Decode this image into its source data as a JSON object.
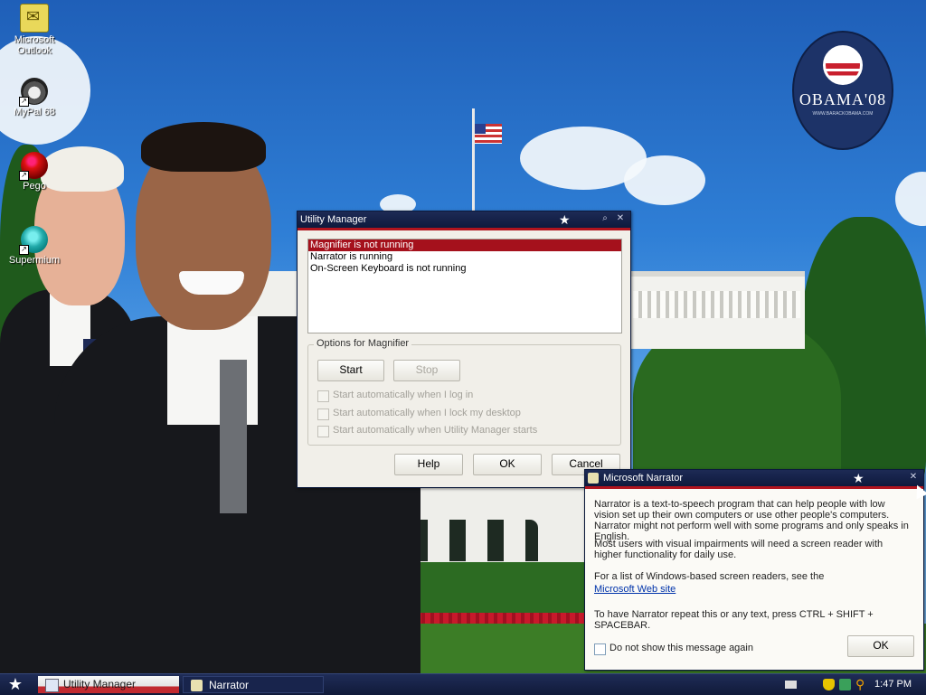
{
  "desktop": {
    "icons": [
      {
        "label": "Microsoft Outlook",
        "icon": "outlook-icon"
      },
      {
        "label": "MyPal 68",
        "icon": "mypal-icon"
      },
      {
        "label": "Pego",
        "icon": "pego-icon"
      },
      {
        "label": "Supermium",
        "icon": "supermium-icon"
      }
    ],
    "logo": {
      "text": "OBAMA'08",
      "subtext": "WWW.BARACKOBAMA.COM"
    }
  },
  "utility_manager": {
    "title": "Utility Manager",
    "list": [
      {
        "text": "Magnifier is not running",
        "selected": true
      },
      {
        "text": "Narrator is running",
        "selected": false
      },
      {
        "text": "On-Screen Keyboard is not running",
        "selected": false
      }
    ],
    "options_label": "Options for Magnifier",
    "start_label": "Start",
    "stop_label": "Stop",
    "checkboxes": [
      "Start automatically when I log in",
      "Start automatically when I lock my desktop",
      "Start automatically when Utility Manager starts"
    ],
    "help_label": "Help",
    "ok_label": "OK",
    "cancel_label": "Cancel"
  },
  "narrator": {
    "title": "Microsoft Narrator",
    "para1": "Narrator is a text-to-speech program that can help people with low vision set up their own computers or use other people's computers. Narrator might not perform well with some programs and only speaks in English.",
    "para2": "Most users with visual impairments will need a screen reader with higher functionality for daily use.",
    "para3": "For a list of Windows-based screen readers, see the",
    "link": "Microsoft Web site",
    "para4": "To have Narrator repeat this or any text, press CTRL + SHIFT + SPACEBAR.",
    "checkbox": "Do not show this message again",
    "ok_label": "OK"
  },
  "taskbar": {
    "tasks": [
      "Utility Manager",
      "Narrator"
    ],
    "clock": "1:47 PM"
  },
  "colors": {
    "accent_red": "#a5111c",
    "titlebar": "#0e1a3d",
    "taskbar": "#101a39"
  }
}
